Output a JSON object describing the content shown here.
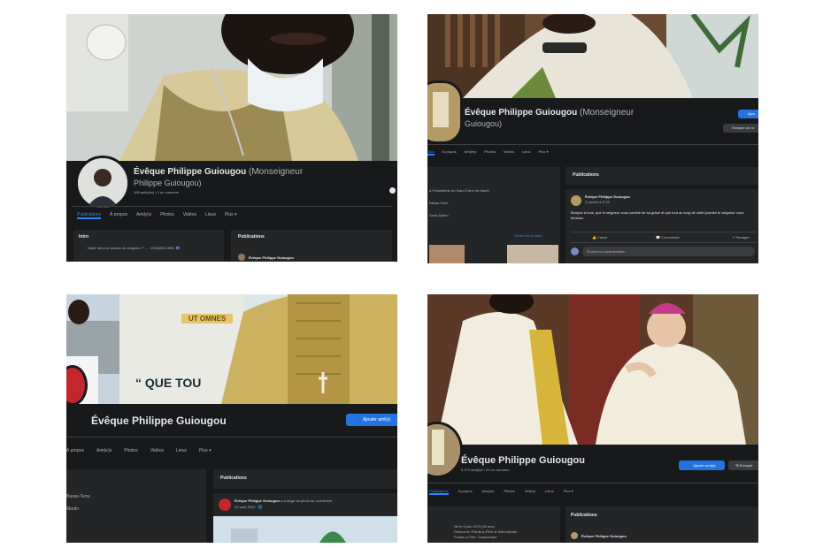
{
  "p1": {
    "name": "Évêque Philippe Guiougou",
    "alt_name": "(Monseigneur",
    "alt_name2": "Philippe Guiougou)",
    "meta": "165 amis(es) • 1 en commun",
    "tabs": [
      "Publications",
      "À propos",
      "Ami(e)s",
      "Photos",
      "Vidéos",
      "Lieux",
      "Plus ▾"
    ],
    "intro_title": "Intro",
    "intro_text": "Notre dans la maison du seigneur ** ... +243825213991 🇨🇩",
    "publications_title": "Publications",
    "post_author": "Évêque Philippe Guiougou"
  },
  "p2": {
    "name": "Évêque Philippe Guiougou",
    "alt_name": "(Monseigneur",
    "alt_name2": "Guiougou)",
    "add_btn": "Ajou",
    "msg_btn": "Envoyer un m",
    "tabs": [
      "Tout",
      "À propos",
      "Ami(e)s",
      "Photos",
      "Vidéos",
      "Lieux",
      "Plus ▾"
    ],
    "intro_lines": [
      "a l'Hostellerie du Saint Cœur de Marie",
      "Basse-Terre",
      "Saint-Martin"
    ],
    "photos_link": "Toutes les photos",
    "publications_title": "Publications",
    "post_author": "Évêque Philippe Guiougou",
    "post_date": "21 janvier à 07:20",
    "post_text": "Bonjour à tous, que le seigneur vous comble de sa grâce et que tout au long de cette journée le seigneur vous bénisse.",
    "actions": [
      "J'aime",
      "Commenter",
      "Partager"
    ],
    "comment_placeholder": "Écrivez un commentaire..."
  },
  "p3": {
    "name": "Évêque Philippe Guiougou",
    "banner_text": "UT OMNES",
    "quote": "“ QUE TOU",
    "add_btn": "Ajouter ami(e)",
    "tabs": [
      "À propos",
      "Ami(e)s",
      "Photos",
      "Vidéos",
      "Lieux",
      "Plus ▾"
    ],
    "left_lines": [
      "Basse-Terre",
      "Martin"
    ],
    "publications_title": "Publications",
    "post_author": "Évêque Philippe Guiougou",
    "post_action": "a changé sa photo de couverture",
    "post_date": "20 août 2023 · 🌐"
  },
  "p4": {
    "name": "Évêque Philippe Guiougou",
    "meta": "5 473 ami(e)s • 23 en commun",
    "add_btn": "Ajouter ami(e)",
    "msg_btn": "Envoyer",
    "tabs": [
      "Publications",
      "À propos",
      "Ami(e)s",
      "Photos",
      "Vidéos",
      "Lieux",
      "Plus ▾"
    ],
    "intro_lines": [
      "Né le 6 juin 1973 (50 ans)",
      "Partout en Pointe-à-Pitre et Saint-Martin",
      "Pointe-à-Pitre, Guadeloupe"
    ],
    "publications_title": "Publications",
    "post_author": "Évêque Philippe Guiougou"
  }
}
